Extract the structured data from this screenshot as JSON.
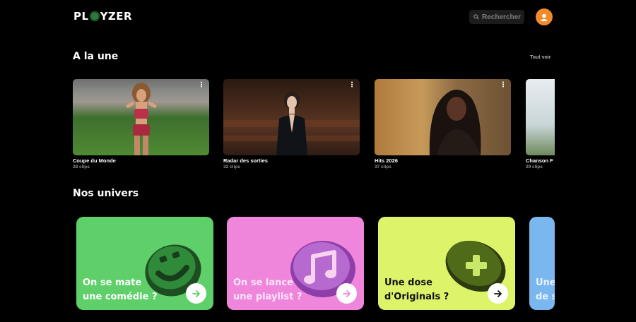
{
  "header": {
    "logo": "PLAYZER",
    "search": {
      "placeholder": "Rechercher"
    }
  },
  "featured": {
    "title": "A la une",
    "see_all": "Tout voir",
    "cards": [
      {
        "title": "Coupe du Monde",
        "subtitle": "28 clips"
      },
      {
        "title": "Radar des sorties",
        "subtitle": "32 clips"
      },
      {
        "title": "Hits 2026",
        "subtitle": "37 clips"
      },
      {
        "title": "Chanson F",
        "subtitle": "29 clips"
      }
    ]
  },
  "universes": {
    "title": "Nos univers",
    "cards": [
      {
        "line1": "On se mate",
        "line2": "une comédie ?",
        "color": "#5fcf6a"
      },
      {
        "line1": "On se lance",
        "line2": "une playlist ?",
        "color": "#ef86dc"
      },
      {
        "line1": "Une dose",
        "line2": "d'Originals ?",
        "color": "#dcf36a"
      },
      {
        "line1": "Une",
        "line2": "de s",
        "color": "#7ab7ef"
      }
    ]
  },
  "icons": [
    "search-icon",
    "user-icon",
    "more-icon",
    "arrow-right-icon",
    "smiley-icon",
    "music-note-icon",
    "plus-icon"
  ]
}
